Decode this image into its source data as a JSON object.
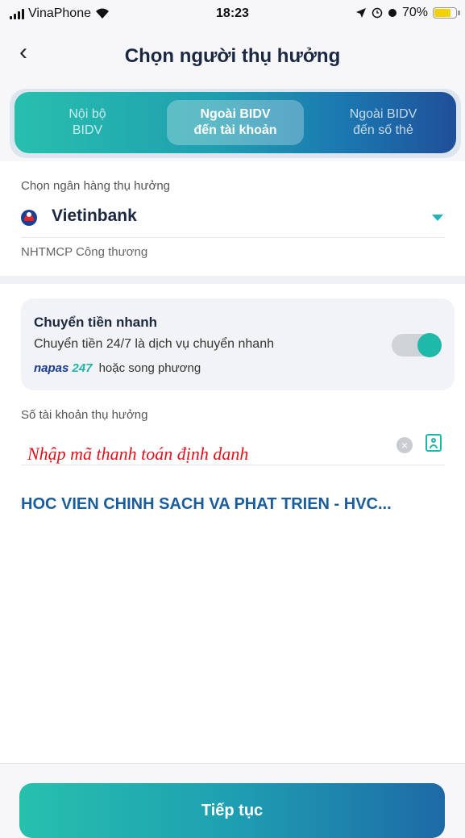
{
  "status_bar": {
    "carrier": "VinaPhone",
    "time": "18:23",
    "battery": "70%"
  },
  "header": {
    "back_glyph": "‹",
    "title": "Chọn người thụ hưởng"
  },
  "tabs": [
    {
      "line1": "Nội bộ",
      "line2": "BIDV",
      "active": false
    },
    {
      "line1": "Ngoài BIDV",
      "line2": "đến tài khoản",
      "active": true
    },
    {
      "line1": "Ngoài BIDV",
      "line2": "đến số thẻ",
      "active": false
    }
  ],
  "bank": {
    "label": "Chọn ngân hàng thụ hưởng",
    "name": "Vietinbank",
    "full_name": "NHTMCP Công thương"
  },
  "fast_transfer": {
    "title": "Chuyển tiền nhanh",
    "description": "Chuyển tiền 24/7 là dịch vụ chuyển nhanh",
    "napas_text": "napas",
    "napas_num": "247",
    "suffix": "hoặc song phương",
    "enabled": true
  },
  "account": {
    "label": "Số tài khoản thụ hưởng",
    "hint_overlay": "Nhập mã thanh toán định danh",
    "clear_glyph": "×"
  },
  "beneficiary_name": "HOC VIEN CHINH SACH VA PHAT TRIEN - HVC...",
  "footer": {
    "continue_label": "Tiếp tục"
  },
  "colors": {
    "accent": "#1fb9a9",
    "brand_blue": "#1a5d9c",
    "hint_red": "#e0111b"
  },
  "icons": [
    "signal-icon",
    "wifi-icon",
    "location-icon",
    "alarm-icon",
    "battery-icon",
    "back-icon",
    "bank-logo-icon",
    "dropdown-caret-icon",
    "clear-icon",
    "contact-icon"
  ]
}
